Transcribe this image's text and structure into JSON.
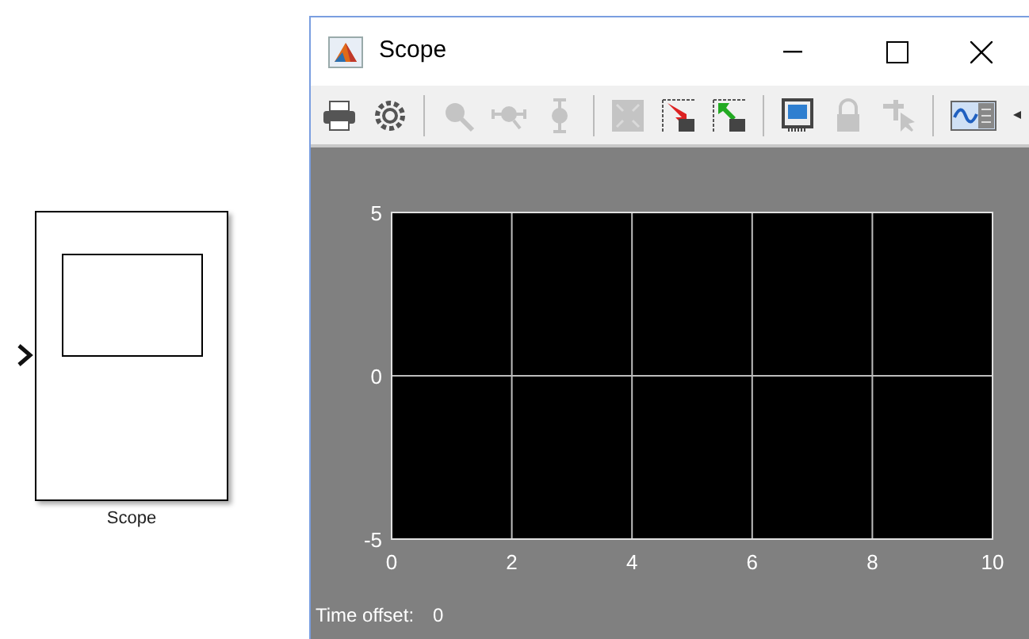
{
  "block": {
    "label": "Scope"
  },
  "window": {
    "title": "Scope"
  },
  "toolbar_groups": [
    {
      "buttons": [
        {
          "disabled": false
        },
        {
          "disabled": false
        }
      ]
    },
    {
      "buttons": [
        {
          "disabled": true
        },
        {
          "disabled": true
        },
        {
          "disabled": true
        }
      ]
    },
    {
      "buttons": [
        {
          "disabled": true
        },
        {
          "disabled": false
        },
        {
          "disabled": false
        }
      ]
    },
    {
      "buttons": [
        {
          "disabled": false
        },
        {
          "disabled": true
        },
        {
          "disabled": true
        }
      ]
    },
    {
      "buttons": [
        {
          "disabled": false
        },
        {
          "disabled": false
        }
      ]
    }
  ],
  "plot": {
    "chart_data": {
      "type": "line",
      "xlim": [
        0,
        10
      ],
      "ylim": [
        -5,
        5
      ],
      "xticks": [
        0,
        2,
        4,
        6,
        8,
        10
      ],
      "yticks": [
        -5,
        0,
        5
      ],
      "grid": true
    }
  },
  "status": {
    "label": "Time offset:",
    "value": "0"
  }
}
